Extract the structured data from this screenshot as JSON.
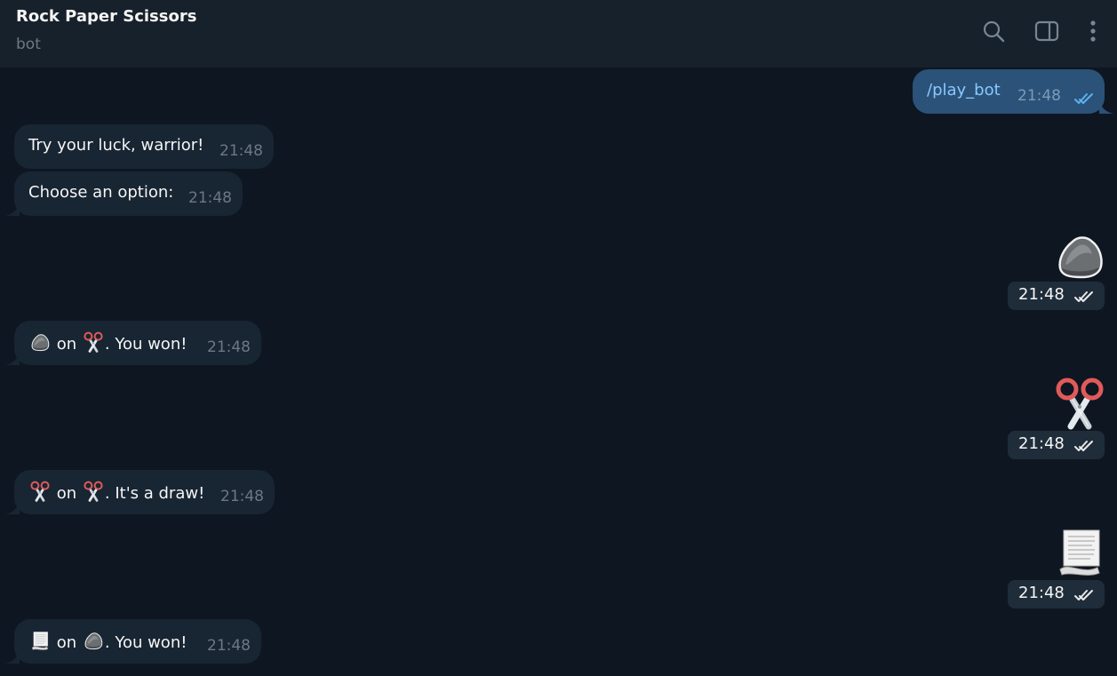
{
  "header": {
    "title": "Rock Paper Scissors",
    "subtitle": "bot",
    "icons": [
      "search-icon",
      "sidebar-toggle-icon",
      "more-vertical-icon"
    ]
  },
  "messages": [
    {
      "direction": "out",
      "type": "text",
      "text": "/play_bot",
      "time": "21:48",
      "status": "read"
    },
    {
      "direction": "in",
      "type": "text",
      "text": "Try your luck, warrior!",
      "time": "21:48"
    },
    {
      "direction": "in",
      "type": "text",
      "text": "Choose an option:",
      "time": "21:48"
    },
    {
      "direction": "out",
      "type": "sticker",
      "sticker": "rock-emoji",
      "time": "21:48",
      "status": "read"
    },
    {
      "direction": "in",
      "type": "text",
      "emoji_a": "rock-emoji",
      "on": "on",
      "emoji_b": "scissors-emoji",
      "text": ". You won!",
      "time": "21:48"
    },
    {
      "direction": "out",
      "type": "sticker",
      "sticker": "scissors-emoji",
      "time": "21:48",
      "status": "read"
    },
    {
      "direction": "in",
      "type": "text",
      "emoji_a": "scissors-emoji",
      "on": "on",
      "emoji_b": "scissors-emoji",
      "text": ". It's a draw!",
      "time": "21:48"
    },
    {
      "direction": "out",
      "type": "sticker",
      "sticker": "paper-emoji",
      "time": "21:48",
      "status": "read"
    },
    {
      "direction": "in",
      "type": "text",
      "emoji_a": "paper-emoji",
      "on": "on",
      "emoji_b": "rock-emoji",
      "text": ". You won!",
      "time": "21:48"
    }
  ],
  "colors": {
    "background": "#0e1621",
    "header": "#17212b",
    "incoming_bubble": "#182533",
    "outgoing_bubble": "#2b5278",
    "timestamp": "#6d7883",
    "command_link": "#8ac8ff"
  }
}
